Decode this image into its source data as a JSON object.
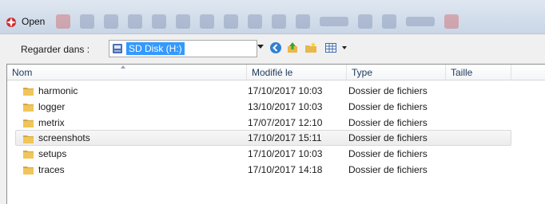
{
  "window": {
    "title": "Open"
  },
  "toolbar": {
    "look_in_label": "Regarder dans :",
    "location_value": "SD Disk (H:)",
    "location_icon": "drive-icon",
    "buttons": [
      "back-icon",
      "up-folder-icon",
      "new-folder-icon",
      "view-menu-icon"
    ]
  },
  "list": {
    "columns": [
      "Nom",
      "Modifié le",
      "Type",
      "Taille"
    ],
    "rows": [
      {
        "name": "harmonic",
        "modified": "17/10/2017 10:03",
        "type": "Dossier de fichiers",
        "size": ""
      },
      {
        "name": "logger",
        "modified": "13/10/2017 10:03",
        "type": "Dossier de fichiers",
        "size": ""
      },
      {
        "name": "metrix",
        "modified": "17/07/2017 12:10",
        "type": "Dossier de fichiers",
        "size": ""
      },
      {
        "name": "screenshots",
        "modified": "17/10/2017 15:11",
        "type": "Dossier de fichiers",
        "size": ""
      },
      {
        "name": "setups",
        "modified": "17/10/2017 10:03",
        "type": "Dossier de fichiers",
        "size": ""
      },
      {
        "name": "traces",
        "modified": "17/10/2017 14:18",
        "type": "Dossier de fichiers",
        "size": ""
      }
    ],
    "selected_row": "screenshots"
  },
  "colors": {
    "selection": "#3399ff",
    "folder": "#e8b84a",
    "header_text": "#1e395b"
  }
}
